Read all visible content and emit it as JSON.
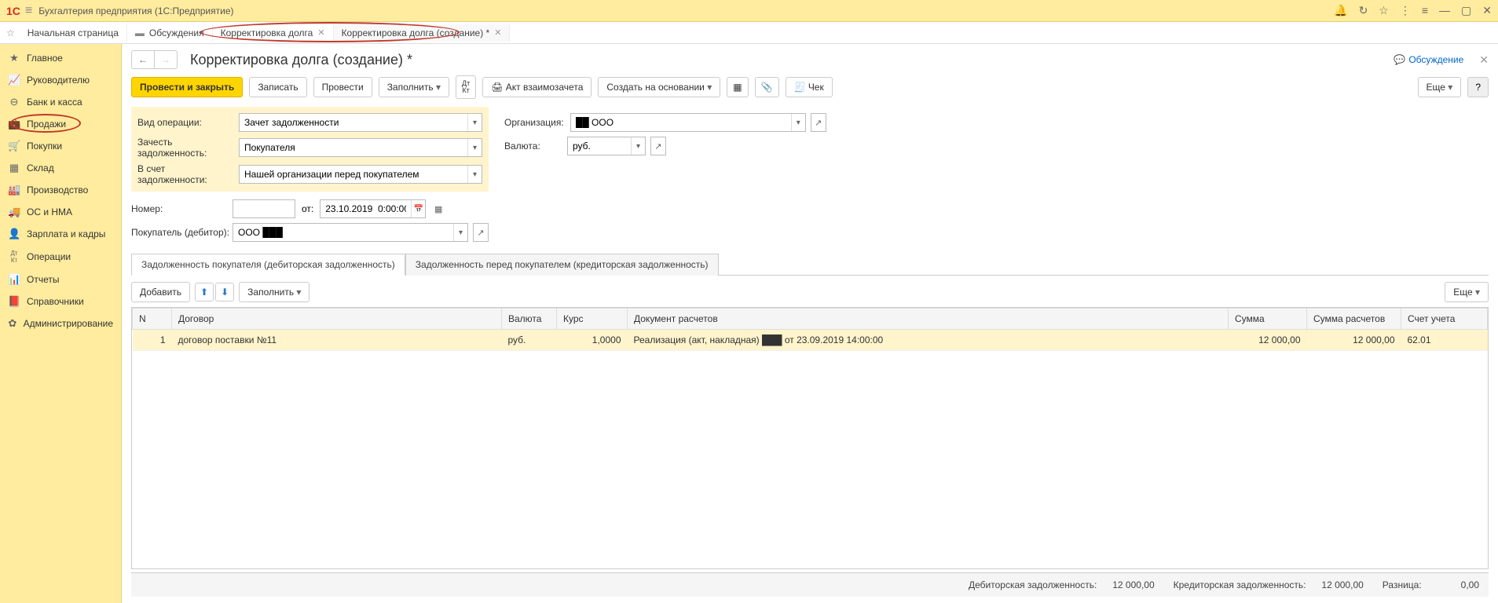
{
  "app": {
    "title": "Бухгалтерия предприятия  (1С:Предприятие)"
  },
  "tabs": {
    "home": "Начальная страница",
    "discussions": "Обсуждения",
    "t1": "Корректировка долга",
    "t2": "Корректировка долга (создание) *"
  },
  "sidebar": [
    "Главное",
    "Руководителю",
    "Банк и касса",
    "Продажи",
    "Покупки",
    "Склад",
    "Производство",
    "ОС и НМА",
    "Зарплата и кадры",
    "Операции",
    "Отчеты",
    "Справочники",
    "Администрирование"
  ],
  "sideicons": [
    "★",
    "📈",
    "⊖",
    "💼",
    "🛒",
    "▦",
    "🏭",
    "🚚",
    "👤",
    "Дт Кт",
    "📊",
    "📕",
    "✿"
  ],
  "page": {
    "title": "Корректировка долга (создание) *",
    "discuss": "Обсуждение"
  },
  "toolbar": {
    "post_close": "Провести и закрыть",
    "write": "Записать",
    "post": "Провести",
    "fill": "Заполнить",
    "dtkt": "Дт Кт",
    "offset_act": "Акт взаимозачета",
    "create_based": "Создать на основании",
    "check": "Чек",
    "more": "Еще"
  },
  "form": {
    "op_type_label": "Вид операции:",
    "op_type_val": "Зачет задолженности",
    "offset_label": "Зачесть задолженность:",
    "offset_val": "Покупателя",
    "against_label": "В счет задолженности:",
    "against_val": "Нашей организации перед покупателем",
    "org_label": "Организация:",
    "org_val": "██ ООО",
    "currency_label": "Валюта:",
    "currency_val": "руб.",
    "number_label": "Номер:",
    "from_label": "от:",
    "date_val": "23.10.2019  0:00:00",
    "buyer_label": "Покупатель (дебитор):",
    "buyer_val": "ООО ███"
  },
  "tabs2": {
    "t1": "Задолженность покупателя (дебиторская задолженность)",
    "t2": "Задолженность перед покупателем (кредиторская задолженность)"
  },
  "table_toolbar": {
    "add": "Добавить",
    "fill": "Заполнить",
    "more": "Еще"
  },
  "table": {
    "headers": {
      "n": "N",
      "contract": "Договор",
      "currency": "Валюта",
      "rate": "Курс",
      "doc": "Документ расчетов",
      "sum": "Сумма",
      "sum_calc": "Сумма расчетов",
      "account": "Счет учета"
    },
    "row": {
      "n": "1",
      "contract": "договор поставки №11",
      "currency": "руб.",
      "rate": "1,0000",
      "doc": "Реализация (акт, накладная) ███ от 23.09.2019 14:00:00",
      "sum": "12 000,00",
      "sum_calc": "12 000,00",
      "account": "62.01"
    }
  },
  "footer": {
    "debit_label": "Дебиторская задолженность:",
    "debit_val": "12 000,00",
    "credit_label": "Кредиторская задолженность:",
    "credit_val": "12 000,00",
    "diff_label": "Разница:",
    "diff_val": "0,00"
  }
}
